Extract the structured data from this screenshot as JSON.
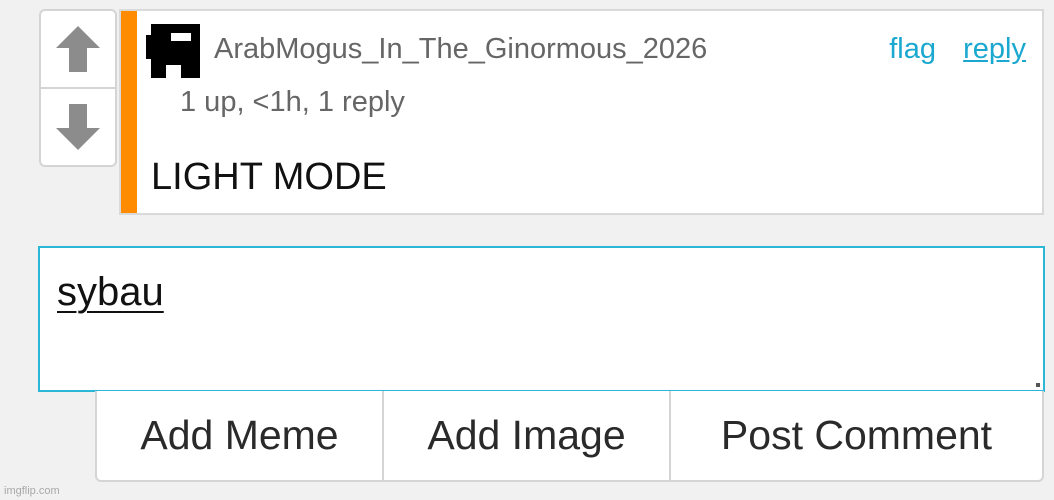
{
  "colors": {
    "accent": "#ff8c00",
    "link": "#1aa8d0",
    "input_border": "#2bb8d6",
    "arrow": "#8c8c8c"
  },
  "vote": {
    "up_icon": "arrow-up-icon",
    "down_icon": "arrow-down-icon"
  },
  "comment": {
    "avatar_icon": "pixel-avatar-icon",
    "username": "ArabMogus_In_The_Ginormous_2026",
    "meta": "1 up, <1h, 1 reply",
    "body": "LIGHT MODE",
    "flag_label": "flag",
    "reply_label": "reply"
  },
  "reply_box": {
    "value": "sybau"
  },
  "actions": {
    "add_meme": "Add Meme",
    "add_image": "Add Image",
    "post_comment": "Post Comment"
  },
  "watermark": "imgflip.com"
}
